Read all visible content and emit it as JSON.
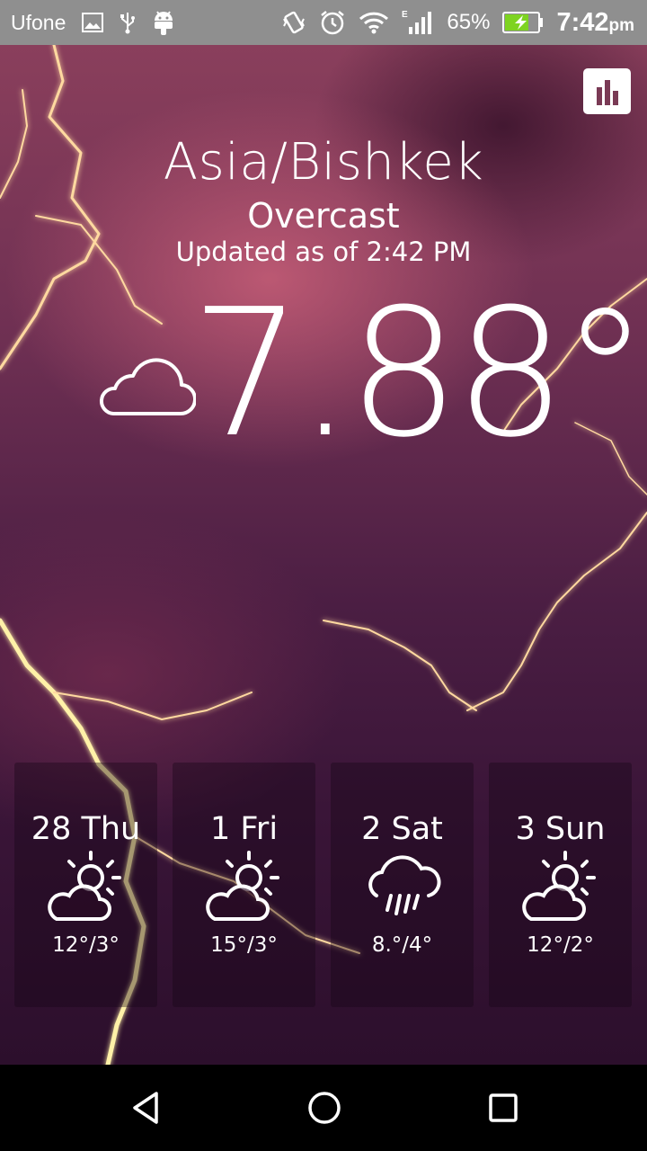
{
  "status_bar": {
    "carrier": "Ufone",
    "battery_percent": "65%",
    "time": "7:42",
    "time_suffix": "pm",
    "icons": [
      "image-icon",
      "usb-icon",
      "android-icon",
      "vibrate-icon",
      "alarm-icon",
      "wifi-icon",
      "signal-icon",
      "battery-charging-icon"
    ]
  },
  "weather": {
    "location": "Asia/Bishkek",
    "condition": "Overcast",
    "updated": "Updated as of 2:42 PM",
    "temperature": "7.88°",
    "condition_icon": "cloud-icon"
  },
  "toolbar": {
    "chart_icon": "bar-chart-icon"
  },
  "forecast": [
    {
      "day": "28 Thu",
      "range": "12°/3°",
      "icon": "partly-sunny-icon"
    },
    {
      "day": "1 Fri",
      "range": "15°/3°",
      "icon": "partly-sunny-icon"
    },
    {
      "day": "2 Sat",
      "range": "8.°/4°",
      "icon": "rain-icon"
    },
    {
      "day": "3 Sun",
      "range": "12°/2°",
      "icon": "partly-sunny-icon"
    }
  ],
  "navigation": {
    "icons": [
      "back-icon",
      "home-icon",
      "recents-icon"
    ]
  },
  "colors": {
    "status_bar": "#8f8f8f",
    "battery": "#7ed321",
    "nav_bar": "#000000"
  }
}
